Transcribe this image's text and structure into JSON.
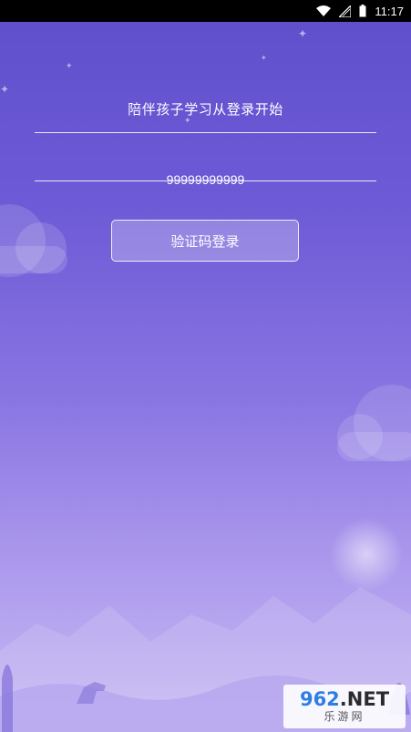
{
  "status_bar": {
    "time": "11:17",
    "icons": [
      "wifi-icon",
      "signal-icon",
      "battery-icon"
    ]
  },
  "login": {
    "tagline": "陪伴孩子学习从登录开始",
    "phone_value": "99999999999",
    "button_label": "验证码登录"
  },
  "watermark": {
    "brand_num": "962",
    "brand_net": ".NET",
    "sub": "乐游网"
  },
  "colors": {
    "bg_top": "#5f4fcb",
    "bg_bottom": "#c8bbf3",
    "text": "#ffffff"
  }
}
